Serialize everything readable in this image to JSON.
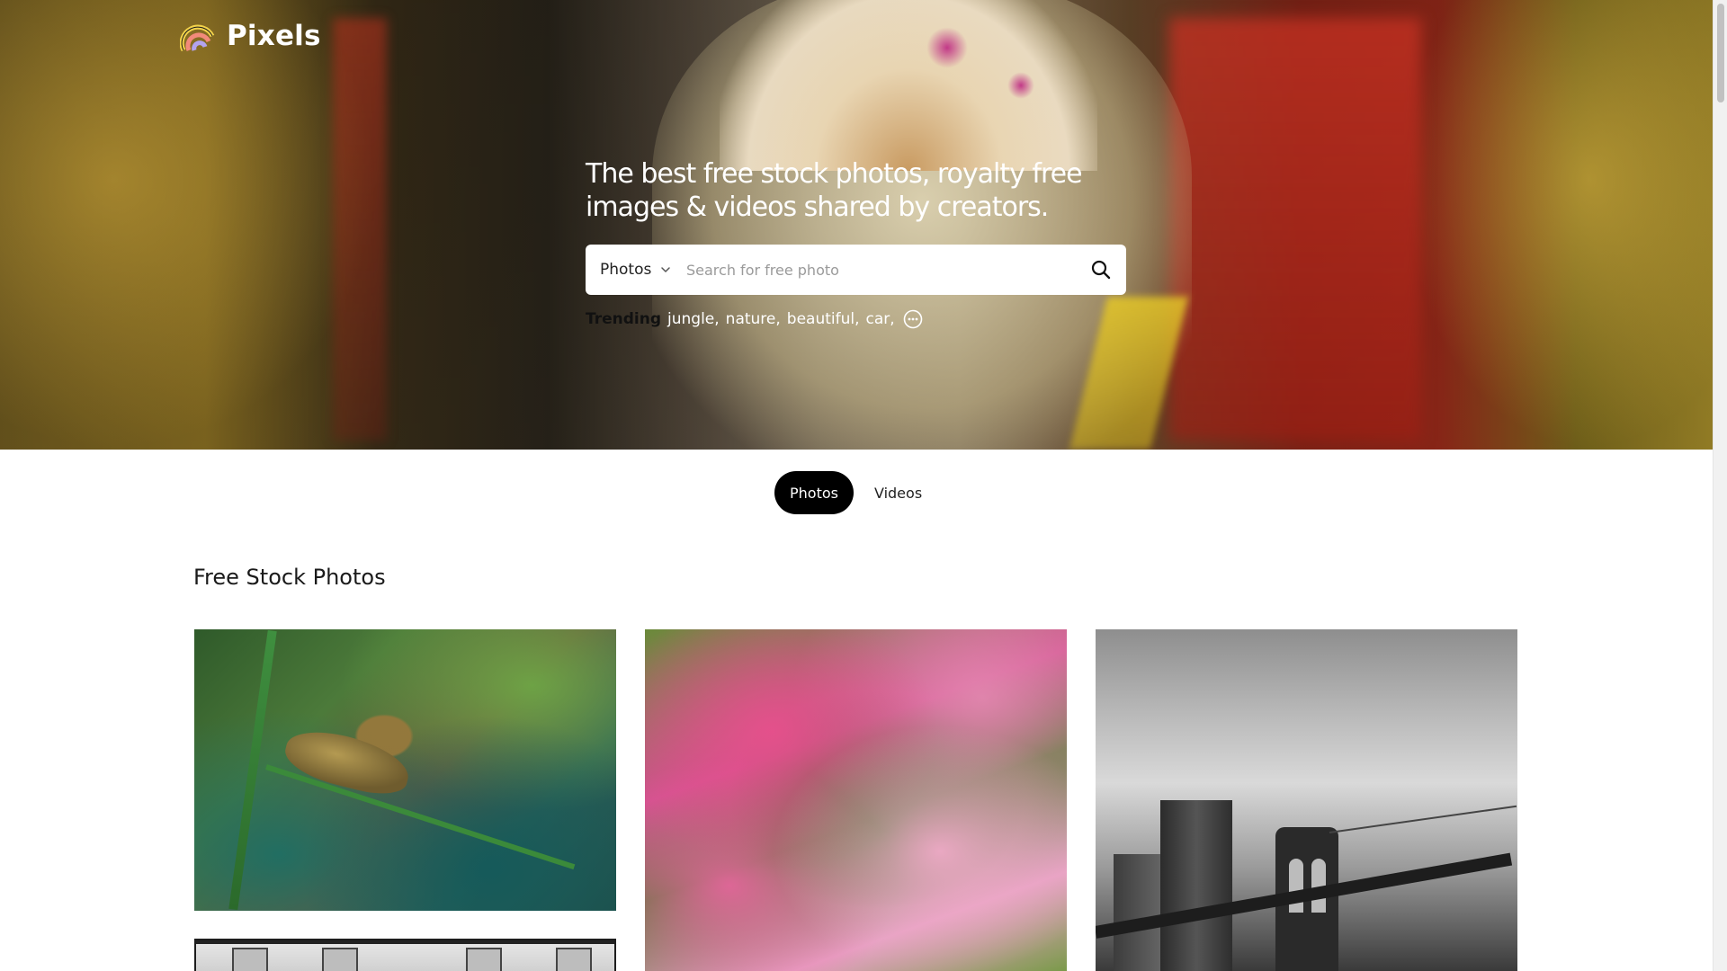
{
  "brand": {
    "name": "Pixels",
    "logo_icon": "rainbow-icon"
  },
  "hero": {
    "headline": "The best free stock photos, royalty free images & videos shared by creators."
  },
  "search": {
    "type_label": "Photos",
    "placeholder": "Search for free photo",
    "submit_icon": "search-icon"
  },
  "trending": {
    "label": "Trending",
    "tags": [
      "jungle,",
      "nature,",
      "beautiful,",
      "car,"
    ],
    "more_icon": "more-dots-icon"
  },
  "tabs": [
    {
      "label": "Photos",
      "active": true
    },
    {
      "label": "Videos",
      "active": false
    }
  ],
  "section": {
    "title": "Free Stock Photos"
  },
  "photos": [
    {
      "subject": "chameleon on green leaves"
    },
    {
      "subject": "pink flowers"
    },
    {
      "subject": "black and white bridge and city"
    },
    {
      "subject": "black and white building facade"
    }
  ],
  "colors": {
    "accent": "#000000",
    "hero_text": "#ffffff",
    "page_bg": "#ffffff"
  }
}
